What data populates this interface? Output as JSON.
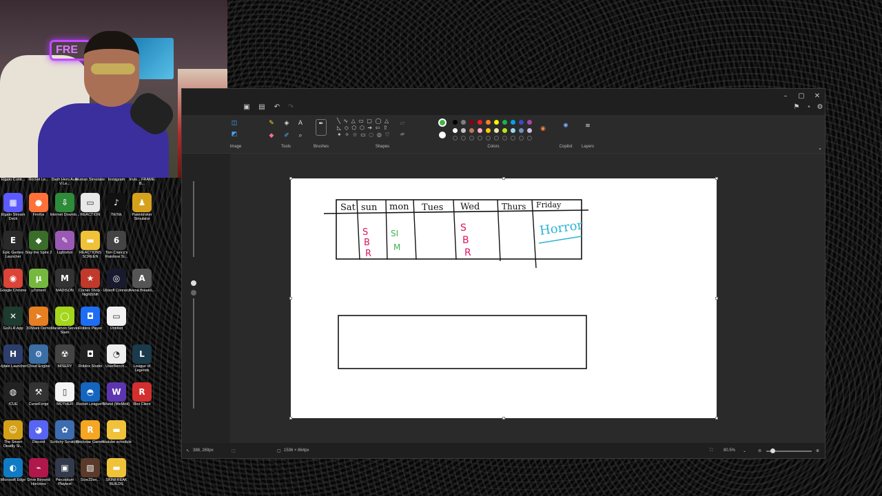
{
  "colors": {
    "window_bg": "#272727",
    "ribbon_bg": "#2b2b2b",
    "canvas_bg": "#ffffff",
    "selected_color": "#3cb84a"
  },
  "webcam": {
    "neon_sign": "FRE"
  },
  "desktop": {
    "top_row_labels": [
      "Elgato Contr...",
      "Rocket Le...",
      "Dash Hero Auto V Le...",
      "Human Simulator",
      "Instagram",
      "Invis... FRAME B..."
    ],
    "icons": [
      {
        "label": "Elgato Stream Deck",
        "icon": "grid-icon",
        "glyph": "▦",
        "color": "#5b5bff"
      },
      {
        "label": "Firefox",
        "icon": "firefox-icon",
        "glyph": "●",
        "color": "#ff7139"
      },
      {
        "label": "Internet Downlo...",
        "icon": "download-icon",
        "glyph": "⇩",
        "color": "#2e8b3a"
      },
      {
        "label": "REACTION",
        "icon": "image-icon",
        "glyph": "▭",
        "color": "#e8e8e8"
      },
      {
        "label": "TikTok",
        "icon": "tiktok-icon",
        "glyph": "♪",
        "color": "#111111"
      },
      {
        "label": "Pawnbroker Simulator",
        "icon": "pawn-icon",
        "glyph": "♟",
        "color": "#d6a21e"
      },
      {
        "label": "Epic Games Launcher",
        "icon": "epic-icon",
        "glyph": "E",
        "color": "#2a2a2a"
      },
      {
        "label": "Slay the Spire 2",
        "icon": "game-icon",
        "glyph": "◆",
        "color": "#3a6d2a"
      },
      {
        "label": "Lightshot",
        "icon": "feather-icon",
        "glyph": "✎",
        "color": "#9b59b6"
      },
      {
        "label": "REACTIONS SCREEN",
        "icon": "folder-icon",
        "glyph": "▬",
        "color": "#f0c23a"
      },
      {
        "label": "Tom Clancy's Rainbow Si...",
        "icon": "r6-icon",
        "glyph": "6",
        "color": "#444444"
      },
      {
        "label": "",
        "icon": "blank-icon",
        "glyph": "",
        "color": "transparent"
      },
      {
        "label": "Google Chrome",
        "icon": "chrome-icon",
        "glyph": "◉",
        "color": "#db4437"
      },
      {
        "label": "µTorrent",
        "icon": "utorrent-icon",
        "glyph": "µ",
        "color": "#76b83f"
      },
      {
        "label": "MADISON",
        "icon": "madison-icon",
        "glyph": "M",
        "color": "#333333"
      },
      {
        "label": "Corner Shop - NightShift",
        "icon": "shop-icon",
        "glyph": "★",
        "color": "#c0392b"
      },
      {
        "label": "Ubisoft Connect",
        "icon": "ubisoft-icon",
        "glyph": "◎",
        "color": "#1a1a2e"
      },
      {
        "label": "Arena Breako...",
        "icon": "arena-icon",
        "glyph": "A",
        "color": "#555555"
      },
      {
        "label": "GoXLR App",
        "icon": "goxlr-icon",
        "glyph": "✕",
        "color": "#1d3b2e"
      },
      {
        "label": "3DMark Demo",
        "icon": "3dmark-icon",
        "glyph": "➤",
        "color": "#e67e22"
      },
      {
        "label": "Marathon Server Slam",
        "icon": "marathon-icon",
        "glyph": "◯",
        "color": "#a4d61c"
      },
      {
        "label": "Roblox Player",
        "icon": "roblox-icon",
        "glyph": "◘",
        "color": "#1e6ef5"
      },
      {
        "label": "Untitled",
        "icon": "doc-icon",
        "glyph": "▭",
        "color": "#f2f2f2"
      },
      {
        "label": "",
        "icon": "blank-icon",
        "glyph": "",
        "color": "transparent"
      },
      {
        "label": "Hytale Launcher",
        "icon": "hytale-icon",
        "glyph": "H",
        "color": "#2c3e6b"
      },
      {
        "label": "Cheat Engine",
        "icon": "cheat-icon",
        "glyph": "⚙",
        "color": "#3a6ea5"
      },
      {
        "label": "MISERY",
        "icon": "misery-icon",
        "glyph": "☢",
        "color": "#444444"
      },
      {
        "label": "Roblox Studio",
        "icon": "roblox-studio-icon",
        "glyph": "◘",
        "color": "#222222"
      },
      {
        "label": "UserBench...",
        "icon": "bench-icon",
        "glyph": "◔",
        "color": "#eeeeee"
      },
      {
        "label": "League of Legends",
        "icon": "lol-icon",
        "glyph": "L",
        "color": "#1b3a4b"
      },
      {
        "label": "ICUE",
        "icon": "icue-icon",
        "glyph": "◍",
        "color": "#222222"
      },
      {
        "label": "CurseForge",
        "icon": "anvil-icon",
        "glyph": "⚒",
        "color": "#333333"
      },
      {
        "label": "MOTHER",
        "icon": "file-icon",
        "glyph": "▯",
        "color": "#f5f5f5"
      },
      {
        "label": "Rocket League®",
        "icon": "rocket-icon",
        "glyph": "◓",
        "color": "#1565c0"
      },
      {
        "label": "Wand (WeMod)",
        "icon": "wand-icon",
        "glyph": "W",
        "color": "#5e35b1"
      },
      {
        "label": "Riot Client",
        "icon": "riot-icon",
        "glyph": "R",
        "color": "#d32f2f"
      },
      {
        "label": "The Seven Deadly Si...",
        "icon": "sds-icon",
        "glyph": "☺",
        "color": "#d4a017"
      },
      {
        "label": "Discord",
        "icon": "discord-icon",
        "glyph": "◕",
        "color": "#5865f2"
      },
      {
        "label": "Scritchy Scratchy",
        "icon": "scratch-icon",
        "glyph": "✿",
        "color": "#3d6cb0"
      },
      {
        "label": "Rockstar Games ...",
        "icon": "rockstar-icon",
        "glyph": "R",
        "color": "#f5a623"
      },
      {
        "label": "Youtube schedule",
        "icon": "folder-icon",
        "glyph": "▬",
        "color": "#f0c23a"
      },
      {
        "label": "",
        "icon": "blank-icon",
        "glyph": "",
        "color": "transparent"
      },
      {
        "label": "Microsoft Edge",
        "icon": "edge-icon",
        "glyph": "◐",
        "color": "#0f7bc4"
      },
      {
        "label": "Drive Beyond Horizons",
        "icon": "drive-icon",
        "glyph": "⌁",
        "color": "#b0174b"
      },
      {
        "label": "Perceptum Playtest",
        "icon": "perceptum-icon",
        "glyph": "▣",
        "color": "#333a4b"
      },
      {
        "label": "Scre22en...",
        "icon": "screenshot-icon",
        "glyph": "▧",
        "color": "#5a3a2a"
      },
      {
        "label": "SKINFREAK BUILDS",
        "icon": "folder-icon",
        "glyph": "▬",
        "color": "#f0c23a"
      },
      {
        "label": "",
        "icon": "blank-icon",
        "glyph": "",
        "color": "transparent"
      }
    ]
  },
  "paint": {
    "ribbon": {
      "groups": {
        "image": "Image",
        "tools": "Tools",
        "brushes": "Brushes",
        "shapes": "Shapes",
        "colors": "Colors",
        "copilot": "Copilot",
        "layers": "Layers"
      },
      "palette_row1": [
        "#000000",
        "#7f7f7f",
        "#880015",
        "#ed1c24",
        "#ff7f27",
        "#fff200",
        "#22b14c",
        "#00a2e8",
        "#3f48cc",
        "#a349a4"
      ],
      "palette_row2": [
        "#ffffff",
        "#c3c3c3",
        "#b97a57",
        "#ffaec9",
        "#ffc90e",
        "#efe4b0",
        "#b5e61d",
        "#99d9ea",
        "#7092be",
        "#c8bfe7"
      ]
    },
    "statusbar": {
      "cursor_pos": "388, 269px",
      "canvas_size": "1536 × 864px",
      "zoom": "80.5%"
    },
    "drawing": {
      "days": [
        "Sat",
        "sun",
        "mon",
        "Tues",
        "Wed",
        "Thurs",
        "Friday"
      ],
      "sun_letters": [
        "S",
        "B",
        "R"
      ],
      "mon_letters": [
        "SI",
        "M"
      ],
      "wed_letters": [
        "S",
        "B",
        "R"
      ],
      "friday_note": "Horror"
    }
  }
}
